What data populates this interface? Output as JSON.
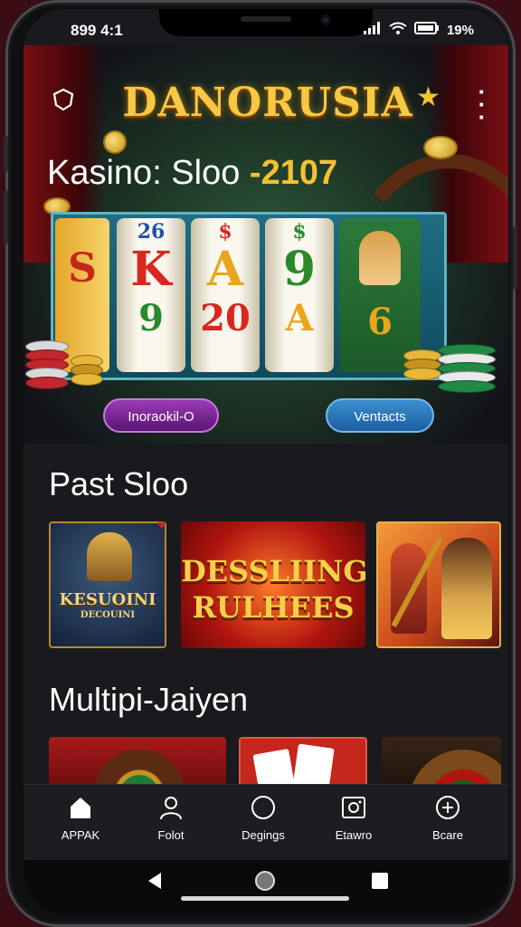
{
  "status_bar": {
    "time": "899 4:1",
    "battery": "19%",
    "icons": [
      "signal-icon",
      "wifi-icon",
      "battery-icon"
    ]
  },
  "header": {
    "brand": "DANORUSIA"
  },
  "hero": {
    "title_prefix": "Kasino: Sloo ",
    "title_number": "-2107",
    "reels": [
      {
        "top": "26",
        "mid": "K",
        "bot": "9",
        "mid_color": "#d8271e",
        "bot_color": "#2a8a2a"
      },
      {
        "top": "$",
        "mid": "A",
        "bot": "20",
        "mid_color": "#e8a71a",
        "bot_color": "#d8271e"
      },
      {
        "top": "$",
        "mid": "9",
        "bot": "A",
        "mid_color": "#2a8a2a",
        "bot_color": "#e8a71a"
      },
      {
        "top": "",
        "mid": "",
        "bot": "6",
        "mid_color": "#e8a71a",
        "bot_color": "#e8a71a"
      }
    ],
    "left_button": "Inoraokil-O",
    "right_button": "Ventacts"
  },
  "past_section": {
    "title": "Past Sloo",
    "games": [
      {
        "label_top": "KESUOINI",
        "label_bottom": "DECOUINI"
      },
      {
        "label_top": "DESSLIING",
        "label_bottom": "RULHEES"
      },
      {
        "label_top": "",
        "label_bottom": ""
      }
    ]
  },
  "multi_section": {
    "title": "Multipi-Jaiyen"
  },
  "bottom_nav": [
    {
      "icon": "home-icon",
      "label": "APPAK"
    },
    {
      "icon": "user-icon",
      "label": "Folot"
    },
    {
      "icon": "circle-icon",
      "label": "Degings"
    },
    {
      "icon": "camera-icon",
      "label": "Etawro"
    },
    {
      "icon": "plus-circle-icon",
      "label": "Bcare"
    }
  ],
  "colors": {
    "gold": "#f4c132",
    "purple": "#7a2594",
    "blue": "#2a77bd",
    "background": "#1a1a1e"
  }
}
